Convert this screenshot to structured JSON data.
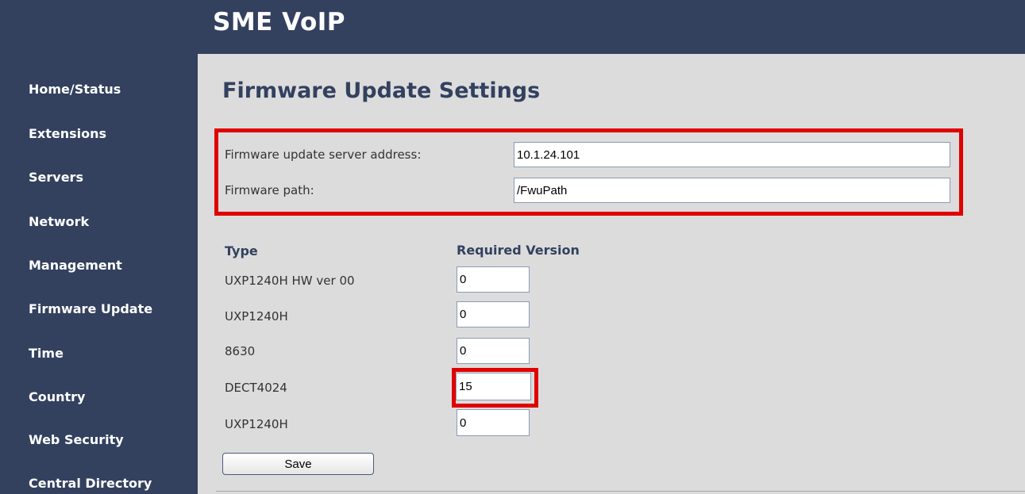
{
  "app": {
    "title": "SME VoIP"
  },
  "sidebar": {
    "items": [
      {
        "label": "Home/Status"
      },
      {
        "label": "Extensions"
      },
      {
        "label": "Servers"
      },
      {
        "label": "Network"
      },
      {
        "label": "Management"
      },
      {
        "label": "Firmware Update"
      },
      {
        "label": "Time"
      },
      {
        "label": "Country"
      },
      {
        "label": "Web Security"
      },
      {
        "label": "Central Directory"
      }
    ]
  },
  "main": {
    "title": "Firmware Update Settings",
    "server_settings": {
      "address_label": "Firmware update server address:",
      "address_value": "10.1.24.101",
      "path_label": "Firmware path:",
      "path_value": "/FwuPath"
    },
    "versions": {
      "type_header": "Type",
      "version_header": "Required Version",
      "rows": [
        {
          "type": "UXP1240H HW ver 00",
          "version": "0"
        },
        {
          "type": "UXP1240H",
          "version": "0"
        },
        {
          "type": "8630",
          "version": "0"
        },
        {
          "type": "DECT4024",
          "version": "15"
        },
        {
          "type": "UXP1240H",
          "version": "0"
        }
      ]
    },
    "save_label": "Save"
  },
  "colors": {
    "nav_background": "#33415f",
    "content_background": "#dcdcdc",
    "highlight": "#e00000",
    "heading": "#33415f"
  }
}
